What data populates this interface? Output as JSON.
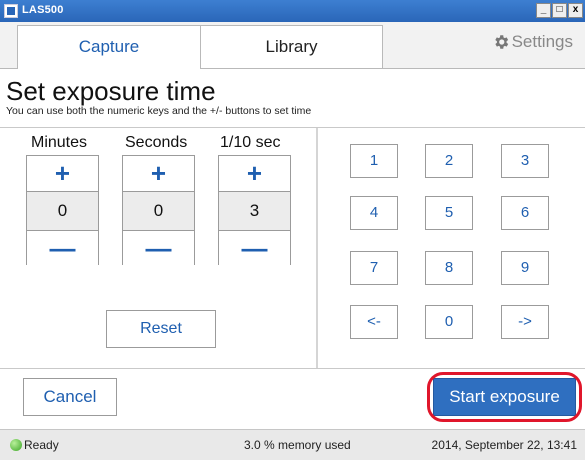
{
  "window": {
    "title": "LAS500",
    "minimize": "_",
    "maximize": "□",
    "close": "x"
  },
  "tabs": {
    "capture": "Capture",
    "library": "Library",
    "settings": "Settings"
  },
  "header": {
    "title": "Set exposure time",
    "subtitle": "You can use both the numeric keys and the +/- buttons to set time"
  },
  "spinners": {
    "minutes": {
      "label": "Minutes",
      "value": "0"
    },
    "seconds": {
      "label": "Seconds",
      "value": "0"
    },
    "tenths": {
      "label": "1/10 sec",
      "value": "3"
    },
    "plus": "+",
    "minus": "—"
  },
  "reset_label": "Reset",
  "keypad": [
    "1",
    "2",
    "3",
    "4",
    "5",
    "6",
    "7",
    "8",
    "9",
    "<-",
    "0",
    "->"
  ],
  "footer": {
    "cancel_label": "Cancel",
    "start_label": "Start exposure"
  },
  "status": {
    "state": "Ready",
    "memory": "3.0 % memory used",
    "datetime": "2014, September 22, 13:41"
  },
  "colors": {
    "accent": "#1f5fb0",
    "primary_button": "#2f6fc0",
    "highlight": "#e0162b",
    "ready_indicator": "#3aa524"
  }
}
